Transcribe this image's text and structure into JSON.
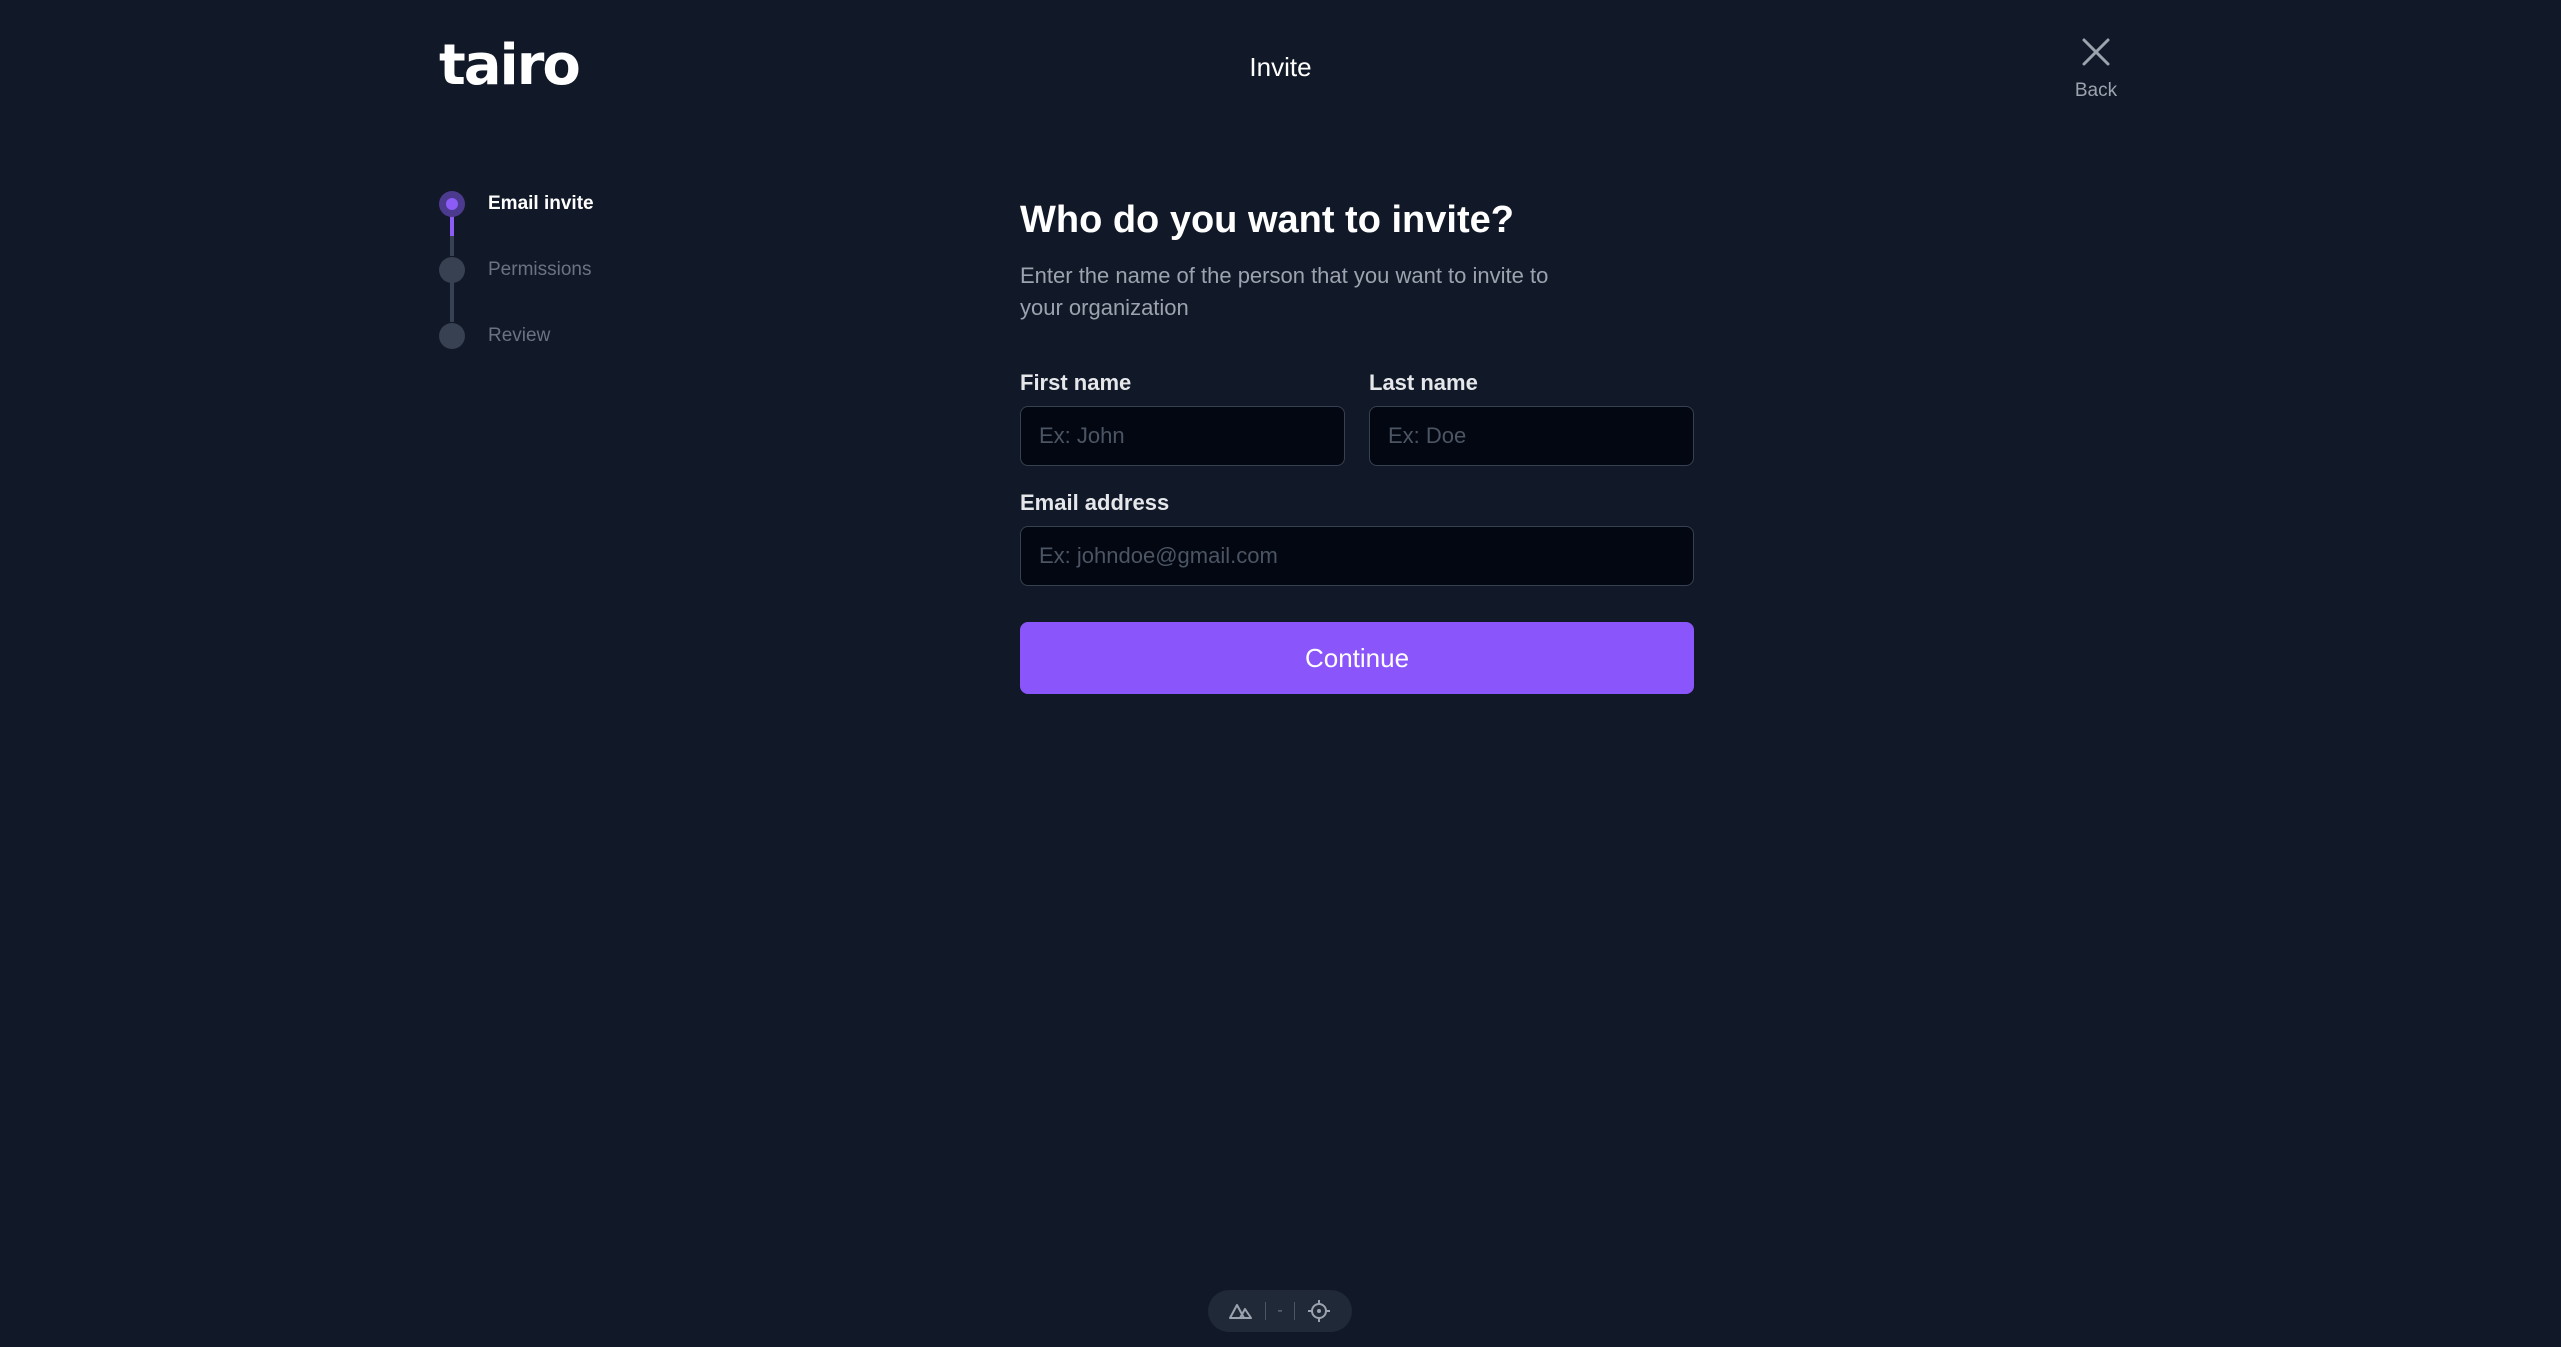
{
  "header": {
    "logo_text": "tairo",
    "title": "Invite",
    "back_label": "Back"
  },
  "stepper": {
    "steps": [
      {
        "label": "Email invite",
        "state": "active"
      },
      {
        "label": "Permissions",
        "state": "pending"
      },
      {
        "label": "Review",
        "state": "pending"
      }
    ]
  },
  "form": {
    "heading": "Who do you want to invite?",
    "description": "Enter the name of the person that you want to invite to your organization",
    "first_name": {
      "label": "First name",
      "placeholder": "Ex: John",
      "value": ""
    },
    "last_name": {
      "label": "Last name",
      "placeholder": "Ex: Doe",
      "value": ""
    },
    "email": {
      "label": "Email address",
      "placeholder": "Ex: johndoe@gmail.com",
      "value": ""
    },
    "continue_label": "Continue"
  },
  "devtools": {
    "separator_text": "-",
    "icons": [
      "nuxt-logo-icon",
      "crosshair-icon"
    ]
  },
  "colors": {
    "background": "#111827",
    "accent": "#8b55fc",
    "input_background": "#030712"
  }
}
